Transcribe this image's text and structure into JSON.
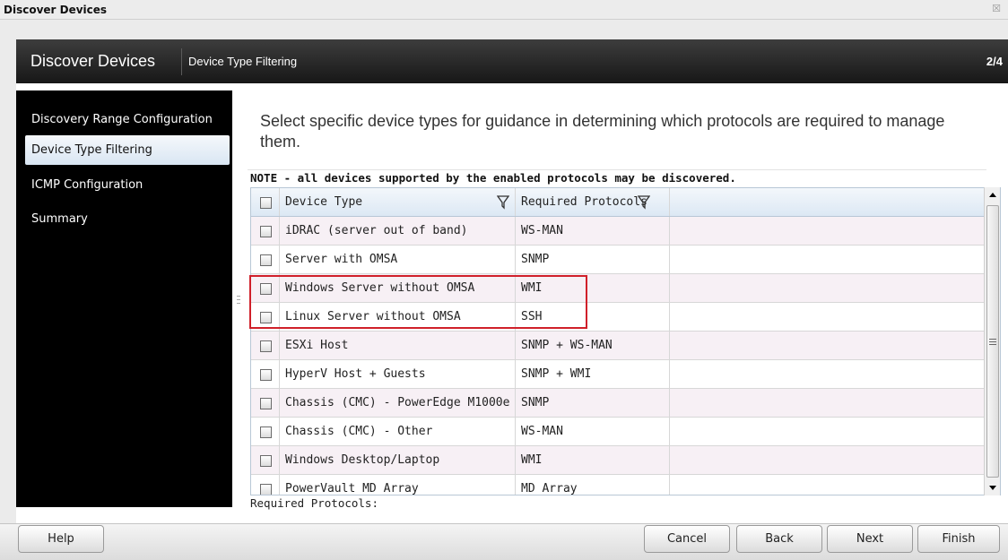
{
  "window": {
    "title": "Discover Devices",
    "close_glyph": "☒"
  },
  "header": {
    "title": "Discover Devices",
    "subtitle": "Device Type Filtering",
    "step": "2/4"
  },
  "sidebar": {
    "items": [
      {
        "label": "Discovery Range Configuration",
        "active": false
      },
      {
        "label": "Device Type Filtering",
        "active": true
      },
      {
        "label": "ICMP Configuration",
        "active": false
      },
      {
        "label": "Summary",
        "active": false
      }
    ]
  },
  "content": {
    "title": "Select specific device types for guidance in determining which protocols are required to manage them.",
    "note": "NOTE - all devices supported by the enabled protocols may be discovered.",
    "required_label": "Required Protocols:"
  },
  "grid": {
    "columns": {
      "device_type": "Device Type",
      "required_protocols": "Required Protocols"
    },
    "rows": [
      {
        "device_type": "iDRAC (server out of band)",
        "protocols": "WS-MAN",
        "checked": false
      },
      {
        "device_type": "Server with OMSA",
        "protocols": "SNMP",
        "checked": false
      },
      {
        "device_type": "Windows Server without OMSA",
        "protocols": "WMI",
        "checked": false
      },
      {
        "device_type": "Linux Server without OMSA",
        "protocols": "SSH",
        "checked": false
      },
      {
        "device_type": "ESXi Host",
        "protocols": "SNMP + WS-MAN",
        "checked": false
      },
      {
        "device_type": "HyperV Host + Guests",
        "protocols": "SNMP + WMI",
        "checked": false
      },
      {
        "device_type": "Chassis (CMC) - PowerEdge M1000e",
        "protocols": "SNMP",
        "checked": false
      },
      {
        "device_type": "Chassis (CMC) - Other",
        "protocols": "WS-MAN",
        "checked": false
      },
      {
        "device_type": "Windows Desktop/Laptop",
        "protocols": "WMI",
        "checked": false
      },
      {
        "device_type": "PowerVault MD Array",
        "protocols": "MD Array",
        "checked": false
      }
    ]
  },
  "footer": {
    "help": "Help",
    "cancel": "Cancel",
    "back": "Back",
    "next": "Next",
    "finish": "Finish"
  },
  "colors": {
    "header_bg": "#1f1f1f",
    "sidebar_bg": "#000000",
    "highlight": "#d0202a",
    "row_alt": "#f7f0f5"
  }
}
